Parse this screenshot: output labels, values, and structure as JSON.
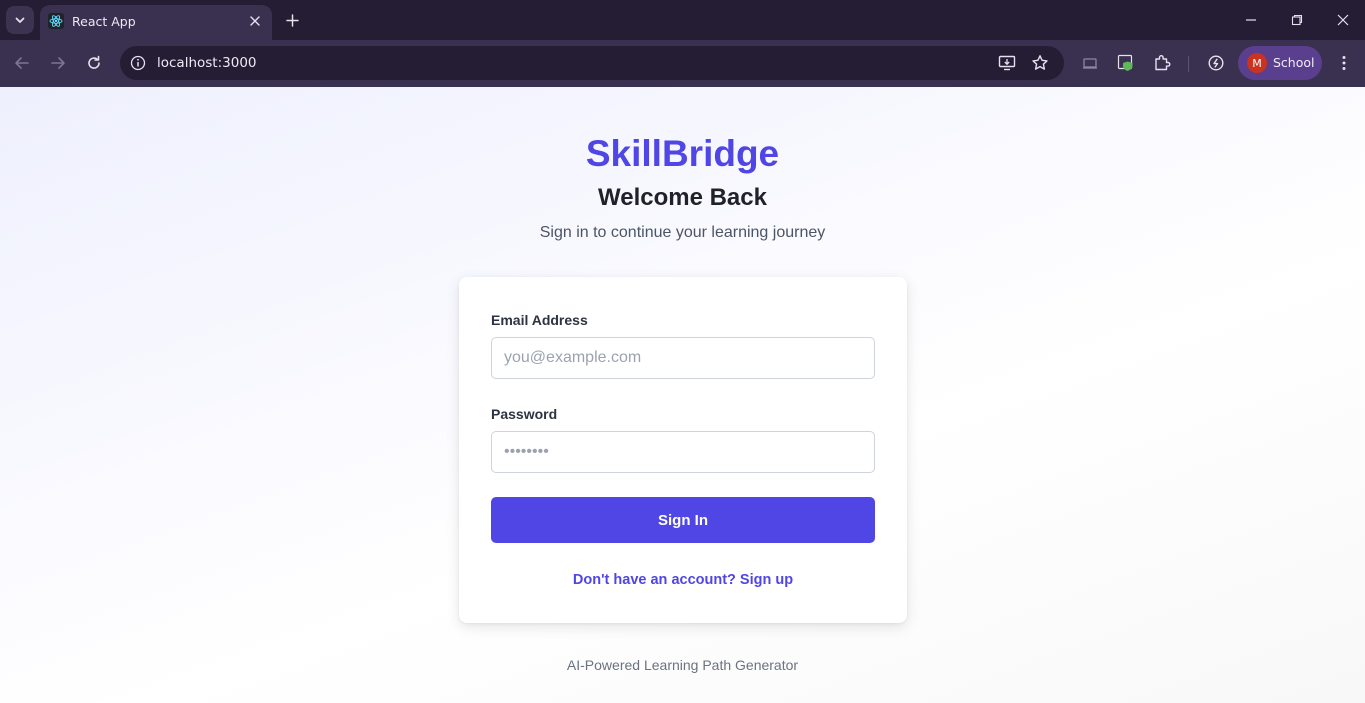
{
  "browser": {
    "tab_title": "React App",
    "url": "localhost:3000",
    "profile_initial": "M",
    "profile_name": "School",
    "icons": [
      "tab-search-icon",
      "react-favicon-icon",
      "close-icon",
      "plus-icon",
      "minimize-icon",
      "restore-icon",
      "window-close-icon",
      "back-arrow-icon",
      "forward-arrow-icon",
      "reload-icon",
      "site-info-icon",
      "install-app-icon",
      "bookmark-star-icon",
      "cast-icon",
      "shield-extension-icon",
      "extensions-puzzle-icon",
      "performance-icon",
      "kebab-menu-icon"
    ]
  },
  "page": {
    "brand": "SkillBridge",
    "heading": "Welcome Back",
    "subtitle": "Sign in to continue your learning journey",
    "form": {
      "email_label": "Email Address",
      "email_placeholder": "you@example.com",
      "password_label": "Password",
      "password_placeholder": "••••••••",
      "submit_label": "Sign In",
      "signup_text": "Don't have an account? Sign up"
    },
    "footer": "AI-Powered Learning Path Generator"
  },
  "colors": {
    "accent": "#4f46e5",
    "tabbar_bg": "#241d33",
    "toolbar_bg": "#3a3150",
    "profile_bg": "#5b3f8f",
    "avatar_bg": "#c9331f"
  }
}
